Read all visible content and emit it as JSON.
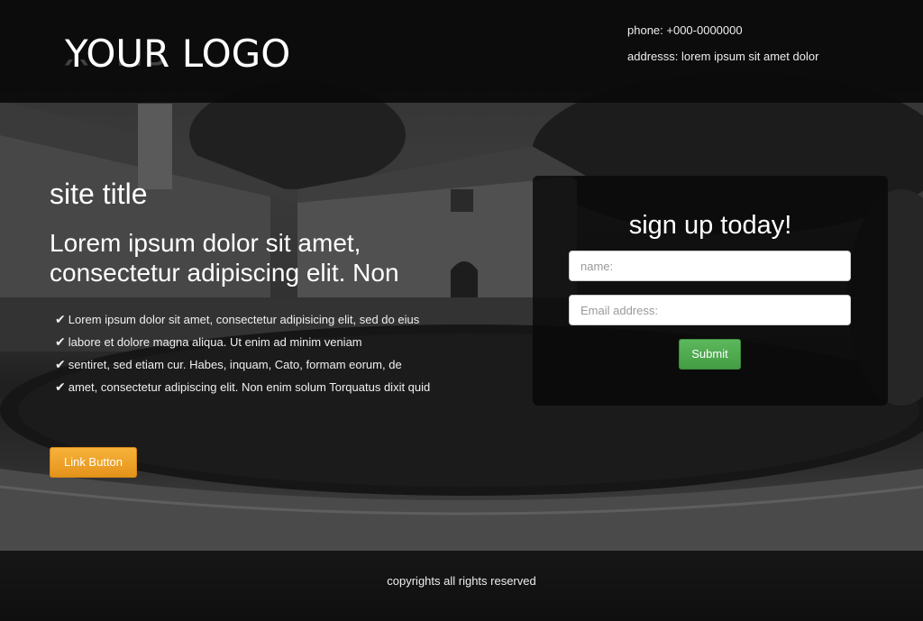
{
  "header": {
    "logo": "YOUR LOGO",
    "phone": "phone: +000-0000000",
    "address": "addresss: lorem ipsum sit amet dolor"
  },
  "hero": {
    "site_title": "site title",
    "tagline": "Lorem ipsum dolor sit amet, consectetur adipiscing elit. Non",
    "features": [
      "Lorem ipsum dolor sit amet, consectetur adipisicing elit, sed do eius",
      "labore et dolore magna aliqua. Ut enim ad minim veniam",
      "sentiret, sed etiam cur. Habes, inquam, Cato, formam eorum, de",
      "amet, consectetur adipiscing elit. Non enim solum Torquatus dixit quid"
    ],
    "check_icon": "✔",
    "link_button": "Link Button"
  },
  "signup": {
    "title": "sign up today!",
    "name_placeholder": "name:",
    "email_placeholder": "Email address:",
    "submit_label": "Submit"
  },
  "footer": {
    "copyright": "copyrights all rights reserved"
  },
  "colors": {
    "link_button": "#f0a22c",
    "submit_button": "#50ad50",
    "overlay": "#0a0a0a"
  }
}
